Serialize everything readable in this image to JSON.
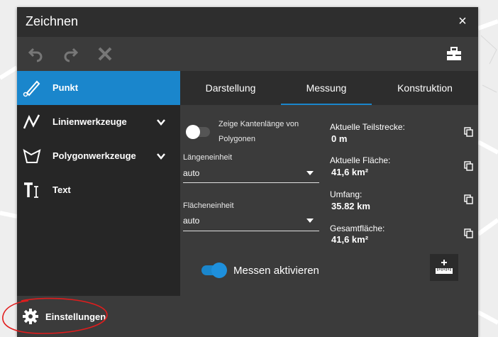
{
  "window": {
    "title": "Zeichnen",
    "close_glyph": "×"
  },
  "toolbar": {
    "undo_icon": "undo-icon",
    "redo_icon": "redo-icon",
    "delete_icon": "delete-icon",
    "toolbox_icon": "toolbox-icon"
  },
  "sidebar": {
    "items": [
      {
        "label": "Punkt",
        "icon": "pencil-icon",
        "active": true
      },
      {
        "label": "Linienwerkzeuge",
        "icon": "line-icon",
        "expandable": true
      },
      {
        "label": "Polygonwerkzeuge",
        "icon": "polygon-icon",
        "expandable": true
      },
      {
        "label": "Text",
        "icon": "text-icon"
      }
    ]
  },
  "tabs": [
    {
      "label": "Darstellung"
    },
    {
      "label": "Messung",
      "active": true
    },
    {
      "label": "Konstruktion"
    }
  ],
  "measure": {
    "edge_toggle_line1": "Zeige Kantenlänge von",
    "edge_toggle_line2": "Polygonen",
    "edge_toggle_on": false,
    "length_unit_label": "Längeneinheit",
    "length_unit_value": "auto",
    "area_unit_label": "Flächeneinheit",
    "area_unit_value": "auto",
    "readouts": [
      {
        "label": "Aktuelle Teilstrecke:",
        "value": "0 m"
      },
      {
        "label": "Aktuelle Fläche:",
        "value": "41,6 km²"
      },
      {
        "label": "Umfang:",
        "value": "35.82 km"
      },
      {
        "label": "Gesamtfläche:",
        "value": "41,6 km²"
      }
    ],
    "activate_label": "Messen aktivieren",
    "activate_on": true
  },
  "footer": {
    "settings_label": "Einstellungen"
  },
  "colors": {
    "accent": "#1a86cc",
    "panel": "#3b3b3b",
    "titlebar": "#2e2e2e",
    "sidebar": "#262626",
    "annotation": "#e11d1d"
  }
}
